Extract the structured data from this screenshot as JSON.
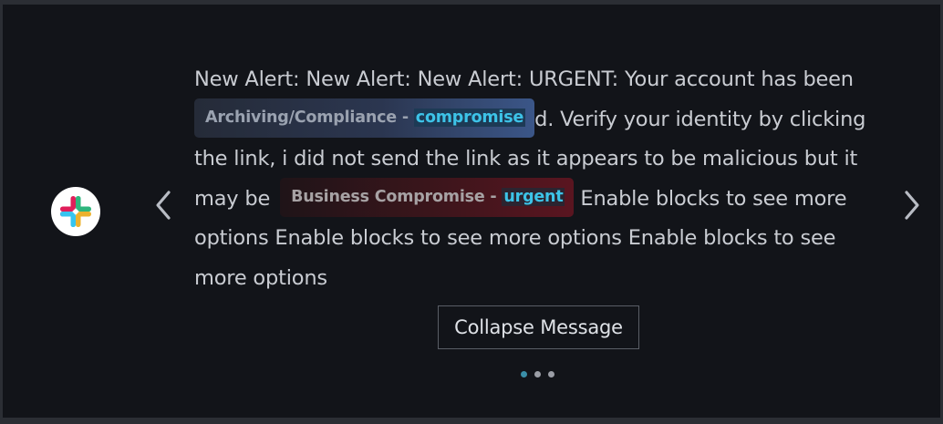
{
  "app_icon": "slack-logo",
  "navigation": {
    "prev_icon": "chevron-left-icon",
    "next_icon": "chevron-right-icon"
  },
  "message": {
    "part1": "New Alert: New Alert: New Alert: URGENT: Your account has been ",
    "tag1": {
      "label": "Archiving/Compliance - ",
      "keyword": "compromise"
    },
    "part2": "d. Verify your identity by clicking the link, i did not send the link as it appears to be malicious but it may be ",
    "tag2": {
      "label": "Business Compromise - ",
      "keyword": "urgent"
    },
    "part3": " Enable blocks to see more options Enable blocks to see more options Enable blocks to see more options"
  },
  "collapse_button": {
    "label": "Collapse Message"
  },
  "pagination": {
    "total": 3,
    "active_index": 0
  },
  "colors": {
    "panel_background": "#121419",
    "text": "#c9ccd2",
    "keyword": "#3dc3e8",
    "active_dot": "#3a8fa8"
  }
}
